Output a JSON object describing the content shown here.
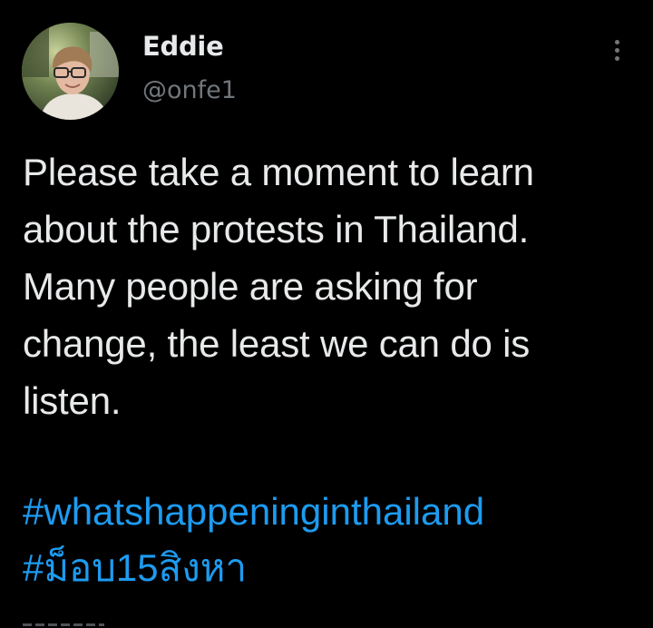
{
  "user": {
    "display_name": "Eddie",
    "handle": "@onfe1",
    "avatar_icon": "profile-photo"
  },
  "tweet": {
    "text_lines": [
      "Please take a moment to learn",
      "about the protests in Thailand.",
      "Many people are asking for",
      "change, the least we can do is",
      "listen."
    ],
    "hashtags": [
      "#whatshappeninginthailand",
      "#ม็อบ15สิงหา"
    ]
  },
  "menu": {
    "icon": "more-vertical-icon"
  },
  "colors": {
    "background": "#000000",
    "primary_text": "#e7e9ea",
    "secondary_text": "#71767b",
    "link": "#1d9bf0"
  }
}
